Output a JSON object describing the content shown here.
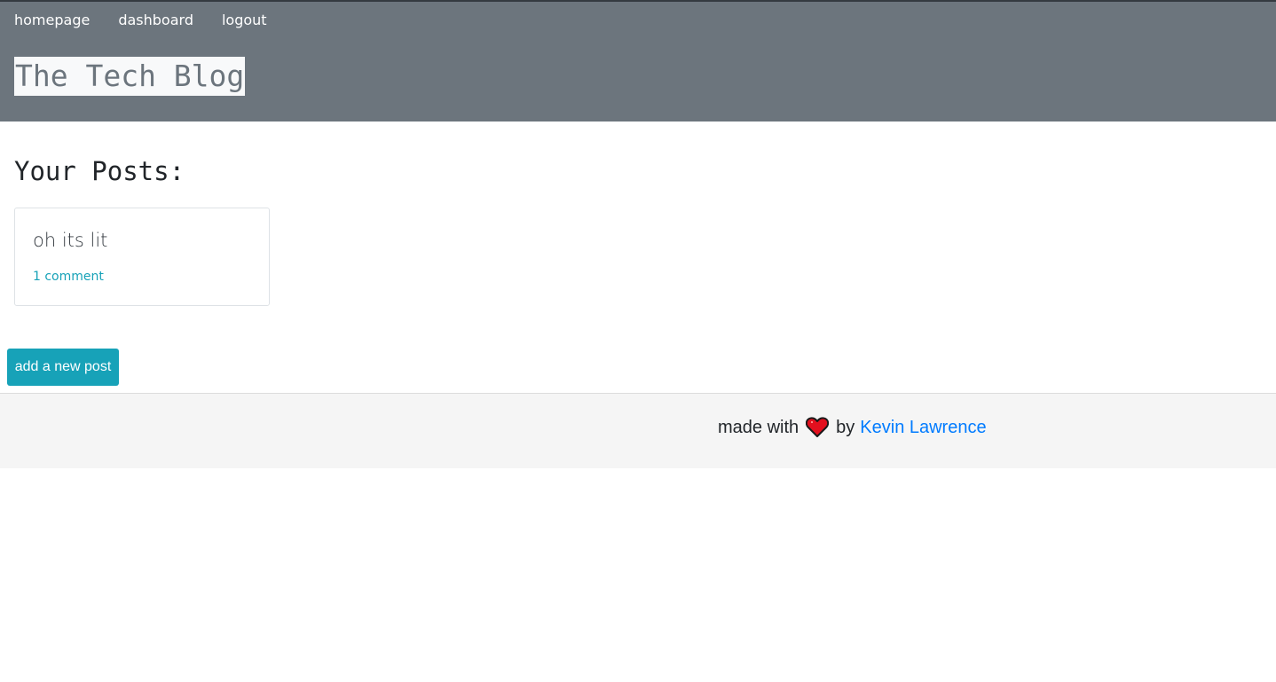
{
  "nav": {
    "items": [
      {
        "label": "homepage"
      },
      {
        "label": "dashboard"
      },
      {
        "label": "logout"
      }
    ]
  },
  "header": {
    "title": "The Tech Blog"
  },
  "main": {
    "heading": "Your Posts:",
    "posts": [
      {
        "title": "oh its lit",
        "comments": "1 comment"
      }
    ],
    "add_button_label": "add a new post"
  },
  "footer": {
    "prefix": "made with",
    "heart_icon": "heart-icon",
    "by": "by",
    "author": "Kevin Lawrence"
  },
  "colors": {
    "header_bg": "#6c757d",
    "accent": "#17a2b8",
    "link": "#007bff",
    "heart": "#e3101e"
  }
}
